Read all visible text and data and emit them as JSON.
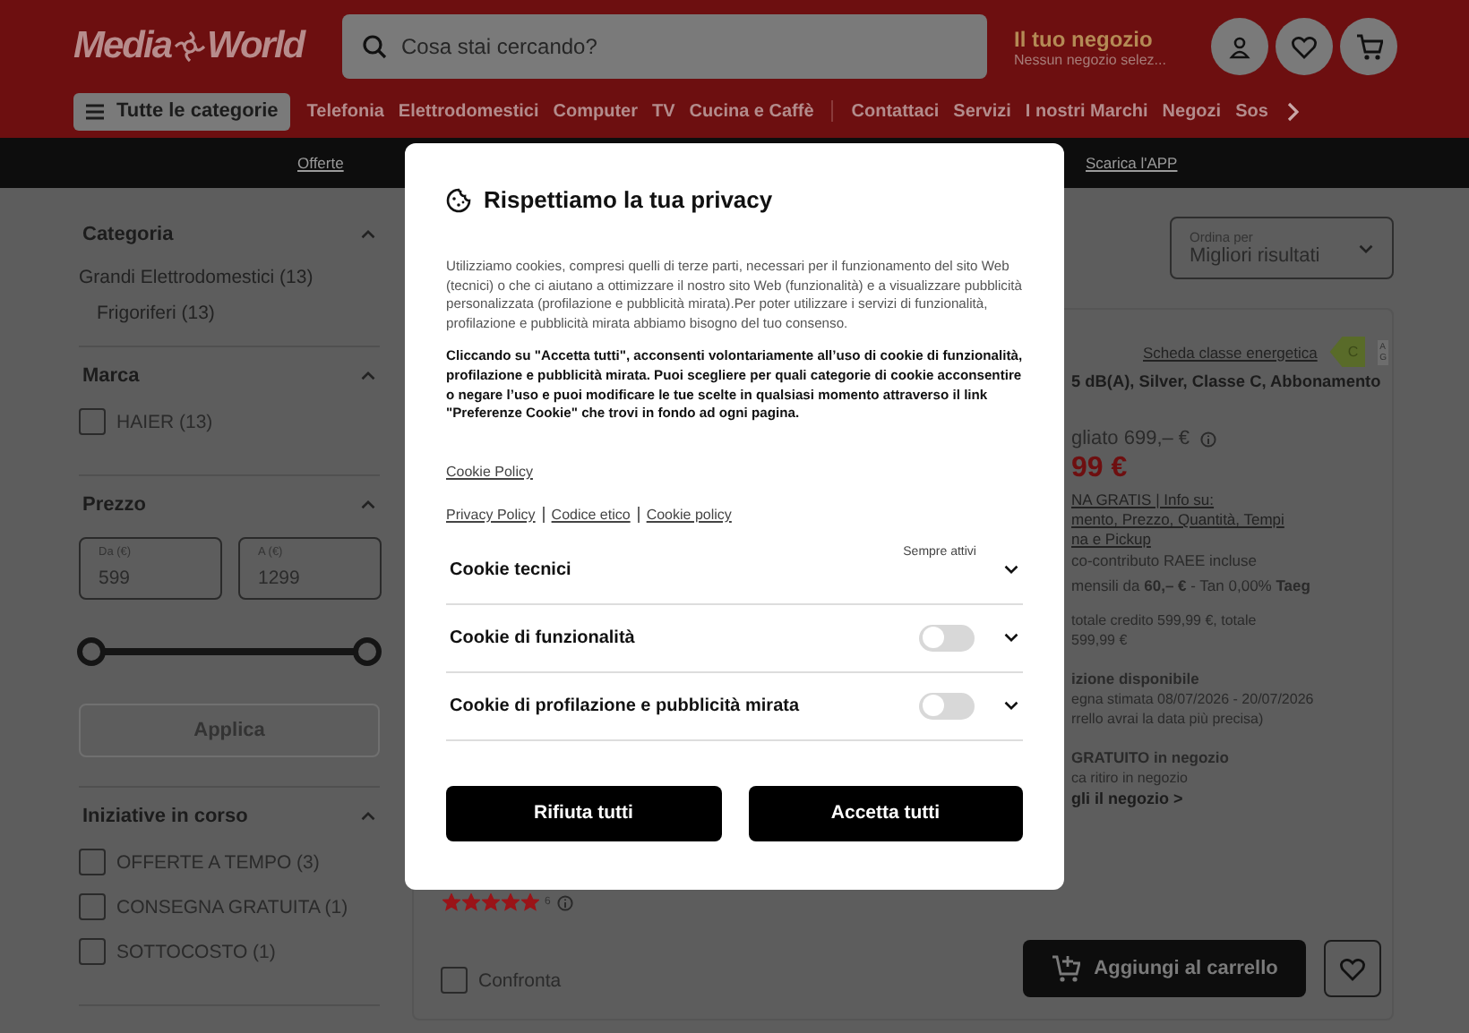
{
  "header": {
    "logo": [
      "Media",
      "World"
    ],
    "search": {
      "placeholder": "Cosa stai cercando?"
    },
    "store": {
      "title": "Il tuo negozio",
      "subtitle": "Nessun negozio selez..."
    },
    "categories_button": "Tutte le categorie",
    "nav_primary": [
      "Telefonia",
      "Elettrodomestici",
      "Computer",
      "TV",
      "Cucina e Caffè"
    ],
    "nav_secondary": [
      "Contattaci",
      "Servizi",
      "I nostri Marchi",
      "Negozi",
      "Sos"
    ]
  },
  "promo_bar": [
    "Offerte",
    "Scarica l'APP"
  ],
  "sidebar": [
    {
      "title": "Categoria",
      "expanded": true,
      "kind": "categories",
      "items": [
        {
          "label": "Grandi Elettrodomestici (13)",
          "children": [
            {
              "label": "Frigoriferi (13)"
            }
          ]
        }
      ]
    },
    {
      "title": "Marca",
      "expanded": true,
      "kind": "checkboxes",
      "items": [
        {
          "label": "HAIER (13)",
          "checked": false
        }
      ]
    },
    {
      "title": "Prezzo",
      "expanded": true,
      "kind": "price",
      "from": {
        "label": "Da (€)",
        "value": "599"
      },
      "to": {
        "label": "A (€)",
        "value": "1299"
      },
      "thumbs": [
        {
          "level": 0
        },
        {
          "level": 1
        }
      ],
      "apply": {
        "label": "Applica",
        "disabled": true
      }
    },
    {
      "title": "Iniziative in corso",
      "expanded": true,
      "kind": "checkboxes",
      "items": [
        {
          "label": "OFFERTE A TEMPO (3)",
          "checked": false
        },
        {
          "label": "CONSEGNA GRATUITA (1)",
          "checked": false
        },
        {
          "label": "SOTTOCOSTO (1)",
          "checked": false
        }
      ]
    }
  ],
  "sort": {
    "label": "Ordina per",
    "value": "Migliori risultati"
  },
  "product": {
    "energy_link": "Scheda classe energetica",
    "energy_class": "C",
    "energy_scale": [
      "A",
      "G"
    ],
    "lines": [
      {
        "kind": "title",
        "text": "5 dB(A), Silver, Classe C,  Abbonamento"
      },
      {
        "kind": "list_price",
        "text": "gliato 699,– €"
      },
      {
        "kind": "price",
        "text": "99 €"
      },
      {
        "kind": "link",
        "text": "NA GRATIS | Info su:"
      },
      {
        "kind": "link",
        "text": "mento, Prezzo, Quantità, Tempi"
      },
      {
        "kind": "link",
        "text": "na e Pickup"
      },
      {
        "kind": "text",
        "text": "co-contributo RAEE incluse"
      },
      {
        "kind": "finance",
        "text": "mensili da **60,– €** - Tan 0,00% **Taeg**"
      },
      {
        "kind": "small",
        "text": "totale credito 599,99 €, totale"
      },
      {
        "kind": "small",
        "text": "599,99 €"
      },
      {
        "kind": "heading",
        "text": "izione disponibile"
      },
      {
        "kind": "small",
        "text": "egna stimata 08/07/2026 - 20/07/2026"
      },
      {
        "kind": "small",
        "text": "rrello avrai la data più precisa)"
      },
      {
        "kind": "heading",
        "text": "GRATUITO in negozio"
      },
      {
        "kind": "small",
        "text": "ca ritiro in negozio"
      },
      {
        "kind": "store_link",
        "text": "gli il negozio >"
      }
    ],
    "stars": 5,
    "review_count": "6",
    "compare": {
      "label": "Confronta",
      "checked": false
    },
    "add_to_cart": "Aggiungi al carrello"
  },
  "cookie_dialog": {
    "title": "Rispettiamo la tua privacy",
    "intro": "Utilizziamo cookies, compresi quelli di terze parti, necessari per il funzionamento del sito Web (tecnici) o che ci aiutano a ottimizzare il nostro sito Web (funzionalità) e a visualizzare pubblicità personalizzata (profilazione e pubblicità mirata).Per poter utilizzare i servizi di funzionalità, profilazione e pubblicità mirata abbiamo bisogno del tuo consenso.",
    "notice": "Cliccando su \"Accetta tutti\", acconsenti volontariamente all’uso di cookie di funzionalità, profilazione e pubblicità mirata. Puoi scegliere per quali categorie di cookie acconsentire o negare l’uso e puoi modificare le tue scelte in qualsiasi momento attraverso il link \"Preferenze Cookie\" che trovi in fondo ad ogni pagina.",
    "policy_link": "Cookie Policy",
    "links": [
      "Privacy Policy",
      "Codice etico",
      "Cookie policy"
    ],
    "categories": [
      {
        "name": "Cookie tecnici",
        "kind": "always",
        "note": "Sempre attivi",
        "expanded": false
      },
      {
        "name": "Cookie di funzionalità",
        "kind": "toggle",
        "on": false,
        "expanded": false
      },
      {
        "name": "Cookie di profilazione e pubblicità mirata",
        "kind": "toggle",
        "on": false,
        "expanded": false
      }
    ],
    "buttons": [
      "Rifiuta tutti",
      "Accetta tutti"
    ]
  }
}
